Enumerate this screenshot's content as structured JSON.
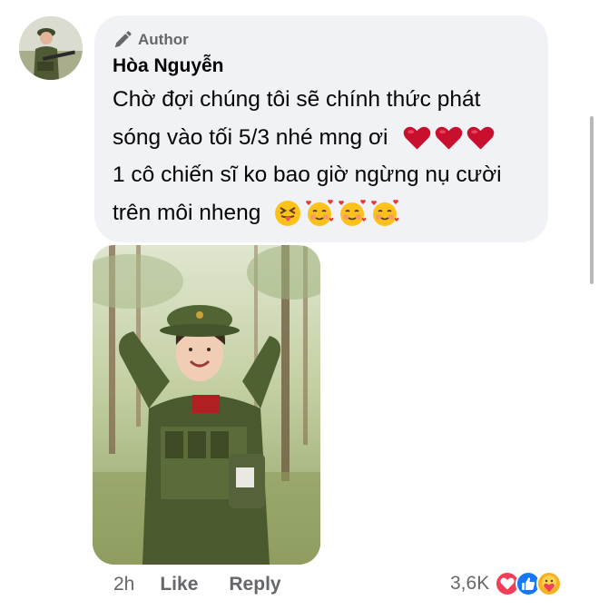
{
  "comment": {
    "badge_icon": "pencil-icon",
    "badge_label": "Author",
    "author_name": "Hòa Nguyễn",
    "text_lines": [
      "Chờ đợi chúng tôi sẽ chính thức phát",
      "sóng vào tối 5/3 nhé mng ơi",
      "1 cô chiến sĩ ko bao giờ ngừng nụ cười",
      "trên môi nheng"
    ],
    "line2_emojis": [
      "heart-emoji",
      "heart-emoji",
      "heart-emoji"
    ],
    "line4_emojis": [
      "squinting-tongue-emoji",
      "smiling-hearts-emoji",
      "smiling-hearts-emoji",
      "smiling-hearts-emoji"
    ]
  },
  "attachment": {
    "type": "photo",
    "subject": "soldier-photo"
  },
  "actions": {
    "time": "2h",
    "like_label": "Like",
    "reply_label": "Reply"
  },
  "reactions": {
    "count": "3,6K",
    "icons": [
      "love-reaction-icon",
      "like-reaction-icon",
      "care-reaction-icon"
    ],
    "colors": {
      "love": "#f33e58",
      "like": "#1877f2",
      "care": "#f7b125"
    }
  }
}
